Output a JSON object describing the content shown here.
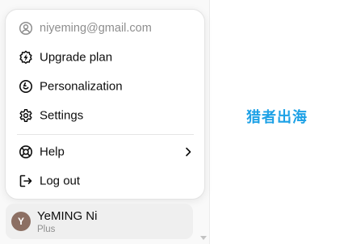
{
  "menu": {
    "email": "niyeming@gmail.com",
    "items": [
      {
        "label": "Upgrade plan",
        "icon": "upgrade-icon"
      },
      {
        "label": "Personalization",
        "icon": "personalization-icon"
      },
      {
        "label": "Settings",
        "icon": "gear-icon"
      }
    ],
    "help_label": "Help",
    "logout_label": "Log out"
  },
  "user": {
    "avatar_initial": "Y",
    "name": "YeMING Ni",
    "plan": "Plus"
  },
  "watermark": "猎者出海",
  "colors": {
    "avatar": "#8c6f63",
    "watermark": "#1da1e6",
    "text": "#0d0d0d",
    "muted": "#8e8e8e"
  }
}
